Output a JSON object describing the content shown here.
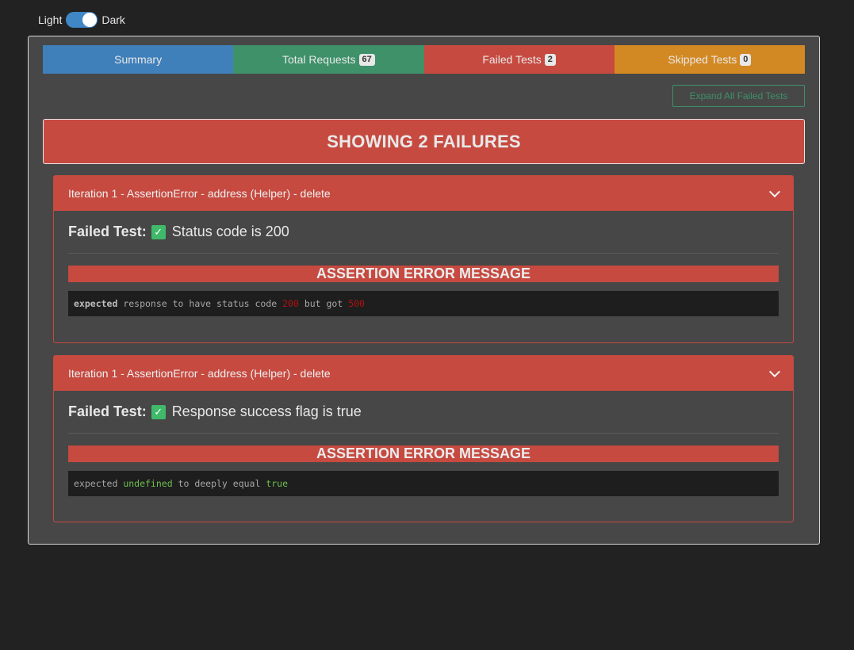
{
  "theme": {
    "light_label": "Light",
    "dark_label": "Dark",
    "is_dark": true
  },
  "tabs": [
    {
      "label": "Summary",
      "badge": null,
      "color": "#3f7fba"
    },
    {
      "label": "Total Requests",
      "badge": "67",
      "color": "#3e9169"
    },
    {
      "label": "Failed Tests",
      "badge": "2",
      "color": "#c64a40"
    },
    {
      "label": "Skipped Tests",
      "badge": "0",
      "color": "#d38923"
    }
  ],
  "expand_button_label": "Expand All Failed Tests",
  "banner_text": "SHOWING 2 FAILURES",
  "failures": [
    {
      "header": "Iteration 1 - AssertionError - address (Helper) - delete",
      "failed_test_label": "Failed Test:",
      "check_icon": "✓",
      "test_name": "Status code is 200",
      "assert_title": "ASSERTION ERROR MESSAGE",
      "message": {
        "w1": "expected",
        "w2": " response to have status code ",
        "w3": "200",
        "w4": " but got ",
        "w5": "500"
      }
    },
    {
      "header": "Iteration 1 - AssertionError - address (Helper) - delete",
      "failed_test_label": "Failed Test:",
      "check_icon": "✓",
      "test_name": "Response success flag is true",
      "assert_title": "ASSERTION ERROR MESSAGE",
      "message": {
        "w1": "expected ",
        "w2": "undefined",
        "w3": " to deeply equal ",
        "w4": "true"
      }
    }
  ],
  "colors": {
    "background": "#222222",
    "panel": "#474747",
    "summary": "#3f7fba",
    "total": "#3e9169",
    "failed": "#c64a40",
    "skipped": "#d38923"
  }
}
